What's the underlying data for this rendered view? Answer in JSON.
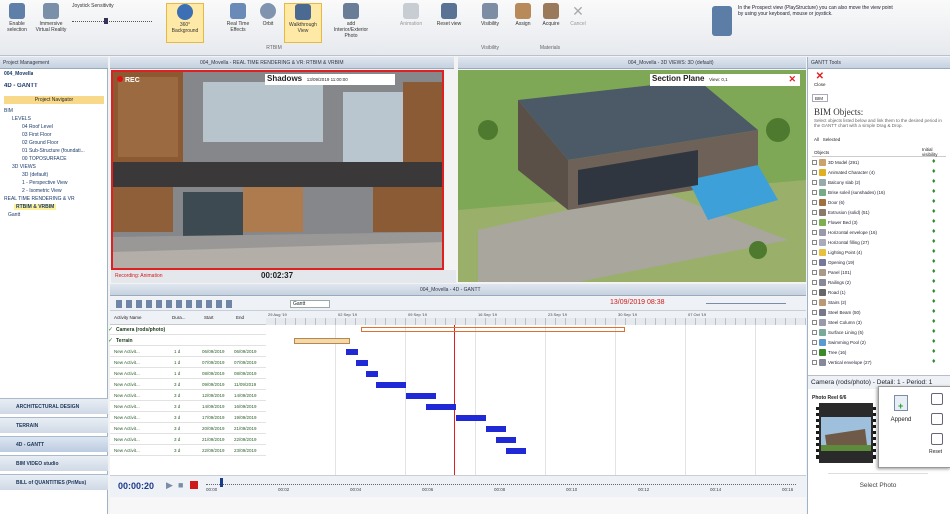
{
  "ribbon": {
    "buttons": [
      {
        "label": "Enable selection"
      },
      {
        "label": "Immersive Virtual Reality"
      },
      {
        "label": "Joystick Sensitivity"
      },
      {
        "label": "360° Background"
      },
      {
        "label": "Real Time Effects"
      },
      {
        "label": "Orbit"
      },
      {
        "label": "Walkthrough View"
      },
      {
        "label": "add Interior/Exterior Photo"
      },
      {
        "label": "Animation"
      },
      {
        "label": "Reset view"
      },
      {
        "label": "Visibility"
      },
      {
        "label": "Assign"
      },
      {
        "label": "Acquire"
      },
      {
        "label": "Cancel"
      }
    ],
    "groups": [
      "RTBIM",
      "Visibility",
      "Materials"
    ],
    "hint": "In the Prospect view (PlayStructure) you can also move the view point by using your keyboard, mouse or joystick."
  },
  "left_panel": {
    "header": "Project Management",
    "project": "004_Movella",
    "title": "4D - GANTT",
    "tab": "Project Navigator",
    "tree": [
      "BIM",
      "LEVELS",
      "04 Roof Level",
      "03 First Floor",
      "02 Ground Floor",
      "01 Sub-Structure (foundati...",
      "00 TOPOSURFACE",
      "3D VIEWS",
      "3D (default)",
      "1 - Perspective View",
      "2 - Isometric View",
      "REAL TIME RENDERING & VR",
      "RTBIM & VRBIM",
      "Gantt"
    ],
    "nav": [
      "ARCHITECTURAL DESIGN",
      "TERRAIN",
      "4D - GANTT",
      "BIM VIDEO studio",
      "BILL of QUANTITIES (PriMus)"
    ]
  },
  "viewport_left": {
    "title": "004_Movella - REAL TIME RENDERING & VR: RTBIM & VRBIM",
    "rec": "REC",
    "shadows_label": "Shadows",
    "shadows_date": "13/09/2019 11:00:00",
    "recording_label": "Recording: Animation",
    "timer": "00:02:37"
  },
  "viewport_right": {
    "title": "004_Movella - 3D VIEWS: 3D (default)",
    "section_label": "Section Plane",
    "section_value": "View: 0,1"
  },
  "gantt": {
    "title": "004_Movella - 4D - GANTT",
    "toolbar_dropdown": "Gantt",
    "current_date": "13/09/2019 08:38",
    "columns": [
      "Activity Name",
      "Dura...",
      "Start",
      "End"
    ],
    "rows": [
      {
        "name": "Camera (rods/photo)",
        "dur": "",
        "start": "",
        "end": "",
        "bold": true
      },
      {
        "name": "Terrain",
        "dur": "",
        "start": "",
        "end": "",
        "bold": true
      },
      {
        "name": "New Activit...",
        "dur": "1 d",
        "start": "06/09/2019",
        "end": "06/09/2019"
      },
      {
        "name": "New Activit...",
        "dur": "1 d",
        "start": "07/09/2019",
        "end": "07/09/2019"
      },
      {
        "name": "New Activit...",
        "dur": "1 d",
        "start": "08/09/2019",
        "end": "08/09/2019"
      },
      {
        "name": "New Activit...",
        "dur": "3 d",
        "start": "09/09/2019",
        "end": "11/09/2019"
      },
      {
        "name": "New Activit...",
        "dur": "3 d",
        "start": "12/09/2019",
        "end": "14/09/2019"
      },
      {
        "name": "New Activit...",
        "dur": "3 d",
        "start": "14/09/2019",
        "end": "16/09/2019"
      },
      {
        "name": "New Activit...",
        "dur": "3 d",
        "start": "17/09/2019",
        "end": "19/09/2019"
      },
      {
        "name": "New Activit...",
        "dur": "3 d",
        "start": "20/09/2019",
        "end": "21/09/2019"
      },
      {
        "name": "New Activit...",
        "dur": "3 d",
        "start": "21/09/2019",
        "end": "22/09/2019"
      },
      {
        "name": "New Activit...",
        "dur": "3 d",
        "start": "22/09/2019",
        "end": "23/09/2019"
      }
    ],
    "timeline_weeks": [
      "29 Aug '19",
      "02 Sep '19",
      "09 Sep '19",
      "16 Sep '19",
      "23 Sep '19",
      "30 Sep '19",
      "07 Oct '19"
    ],
    "playback_time": "00:00:20",
    "ticks": [
      "00:00",
      "00:02",
      "00:04",
      "00:06",
      "00:08",
      "00:10",
      "00:12",
      "00:14",
      "00:16"
    ]
  },
  "right_panel": {
    "header": "GANTT Tools",
    "close_label": "Close",
    "tab": "BIM",
    "heading": "BIM Objects:",
    "description": "Select objects listed below and link them to the desired period in the GANTT chart with a simple Drag & Drop.",
    "filter_all": "All",
    "filter_selected": "Selected",
    "col_objects": "Objects",
    "col_visibility": "Initial visibility",
    "objects": [
      "3D Model (291)",
      "Animated Character (4)",
      "Balcony slab (2)",
      "Brise soleil (sunshades) (16)",
      "Door (6)",
      "Extrusion (solid) (51)",
      "Flower Bed (3)",
      "Horizontal envelope (16)",
      "Horizontal filling (27)",
      "Lighting Point (4)",
      "Opening (19)",
      "Panel (101)",
      "Railings (2)",
      "Road (1)",
      "Stairs (2)",
      "Steel Beam (50)",
      "Steel Column (3)",
      "Surface Lining (5)",
      "Swimming Pool (2)",
      "Tree (16)",
      "Vertical envelope (27)"
    ],
    "camera_title": "Camera (rods/photo) - Detail: 1 - Period: 1",
    "photo_reel": "Photo Reel 6/6",
    "select_photo": "Select Photo",
    "append": "Append",
    "reset_label": "Reset"
  }
}
